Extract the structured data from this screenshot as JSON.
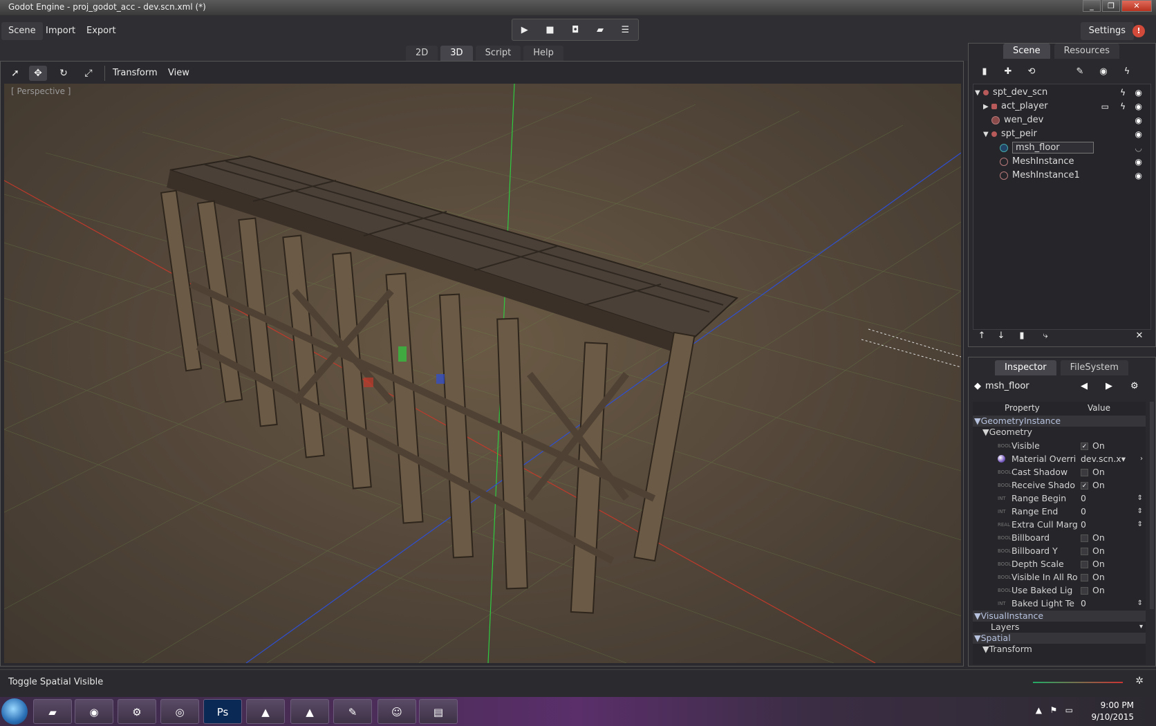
{
  "window": {
    "title": "Godot Engine - proj_godot_acc - dev.scn.xml (*)",
    "buttons": [
      "_",
      "❐",
      "✕"
    ]
  },
  "menubar": {
    "items": [
      "Scene",
      "Import",
      "Export"
    ],
    "settings": "Settings",
    "alert": "!"
  },
  "playbar": {
    "buttons": [
      "play-icon",
      "stop-icon",
      "pause-icon",
      "movie-icon",
      "list-icon"
    ]
  },
  "mode_tabs": [
    "2D",
    "3D",
    "Script",
    "Help"
  ],
  "mode_tabs_active": "3D",
  "viewport": {
    "menus": [
      "Transform",
      "View"
    ],
    "perspective_label": "[ Perspective ]"
  },
  "scene_dock": {
    "tabs": [
      "Scene",
      "Resources"
    ],
    "active_tab": "Scene",
    "tree": [
      {
        "label": "spt_dev_scn"
      },
      {
        "label": "act_player"
      },
      {
        "label": "wen_dev"
      },
      {
        "label": "spt_peir"
      },
      {
        "label": "msh_floor"
      },
      {
        "label": "MeshInstance"
      },
      {
        "label": "MeshInstance1"
      }
    ],
    "selected": "msh_floor"
  },
  "inspector": {
    "tabs": [
      "Inspector",
      "FileSystem"
    ],
    "active_tab": "Inspector",
    "title": "msh_floor",
    "columns": [
      "Property",
      "Value"
    ],
    "sections": {
      "geometry_instance": "GeometryInstance",
      "geometry": "Geometry",
      "visual_instance": "VisualInstance",
      "spatial": "Spatial",
      "transform": "Transform"
    },
    "rows": [
      {
        "type": "BOOL",
        "name": "Visible",
        "value": "On",
        "checked": "✓"
      },
      {
        "type": "",
        "name": "Material Overri",
        "value": "dev.scn.x▾",
        "checked": ""
      },
      {
        "type": "BOOL",
        "name": "Cast Shadow",
        "value": "On",
        "checked": ""
      },
      {
        "type": "BOOL",
        "name": "Receive Shado",
        "value": "On",
        "checked": "✓"
      },
      {
        "type": "INT",
        "name": "Range Begin",
        "value": "0",
        "checked": ""
      },
      {
        "type": "INT",
        "name": "Range End",
        "value": "0",
        "checked": ""
      },
      {
        "type": "REAL",
        "name": "Extra Cull Marg",
        "value": "0",
        "checked": ""
      },
      {
        "type": "BOOL",
        "name": "Billboard",
        "value": "On",
        "checked": ""
      },
      {
        "type": "BOOL",
        "name": "Billboard Y",
        "value": "On",
        "checked": ""
      },
      {
        "type": "BOOL",
        "name": "Depth Scale",
        "value": "On",
        "checked": ""
      },
      {
        "type": "BOOL",
        "name": "Visible In All Ro",
        "value": "On",
        "checked": ""
      },
      {
        "type": "BOOL",
        "name": "Use Baked Lig",
        "value": "On",
        "checked": ""
      },
      {
        "type": "INT",
        "name": "Baked Light Te",
        "value": "0",
        "checked": ""
      }
    ],
    "layers_label": "Layers"
  },
  "status": {
    "text": "Toggle Spatial Visible"
  },
  "taskbar": {
    "time": "9:00 PM",
    "date": "9/10/2015",
    "apps": [
      "Ps"
    ]
  },
  "colors": {
    "accent_red": "#d24a3a",
    "panel": "#2a2a2e",
    "viewport_bg": "#5a4c3d",
    "axis_x": "#c0392b",
    "axis_y": "#2ecc40",
    "axis_z": "#2d4fd4"
  }
}
